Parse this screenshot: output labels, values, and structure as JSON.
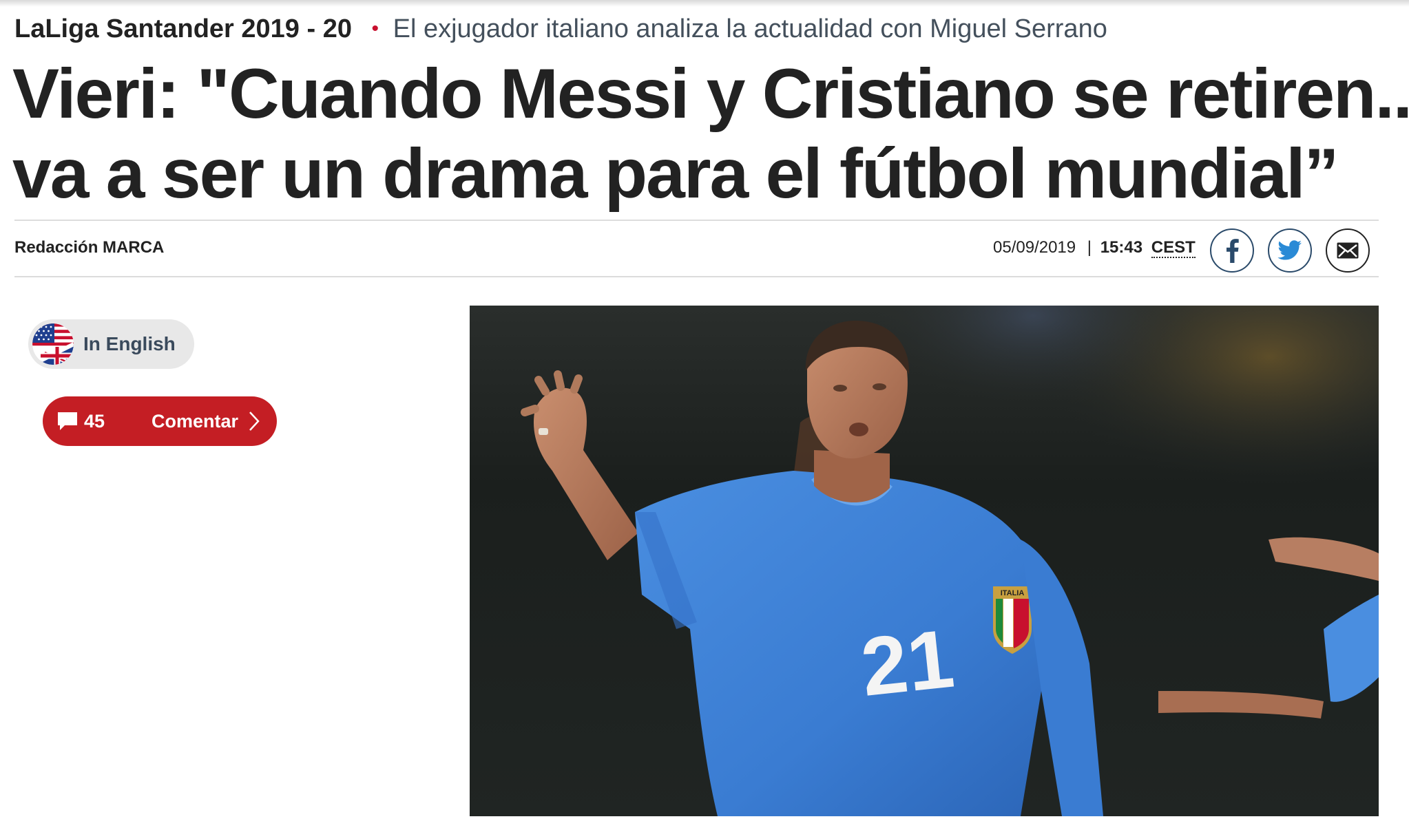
{
  "kicker": {
    "section": "LaLiga Santander 2019 - 20",
    "bullet": "•",
    "summary": "El exjugador italiano analiza la actualidad con Miguel Serrano"
  },
  "headline": {
    "line1": "Vieri: \"Cuando Messi y Cristiano se retiren...",
    "line2": "va a ser un drama para el fútbol mundial”"
  },
  "byline": {
    "author": "Redacción MARCA",
    "date": "05/09/2019",
    "separator": "|",
    "time": "15:43",
    "timezone": "CEST"
  },
  "share": {
    "icons": [
      "facebook-icon",
      "twitter-icon",
      "mail-icon"
    ],
    "color": "#2a4a6a"
  },
  "language_toggle": {
    "label": "In English",
    "icon": "us-uk-flag-icon"
  },
  "comments": {
    "count": "45",
    "label": "Comentar",
    "color": "#c41e24"
  },
  "photo": {
    "jersey_number": "21",
    "badge_text": "ITALIA"
  },
  "colors": {
    "accent_red": "#c8102e",
    "text": "#222222",
    "muted": "#44505c",
    "rule": "#dcdcdc",
    "jersey_blue": "#3d7fd6"
  }
}
